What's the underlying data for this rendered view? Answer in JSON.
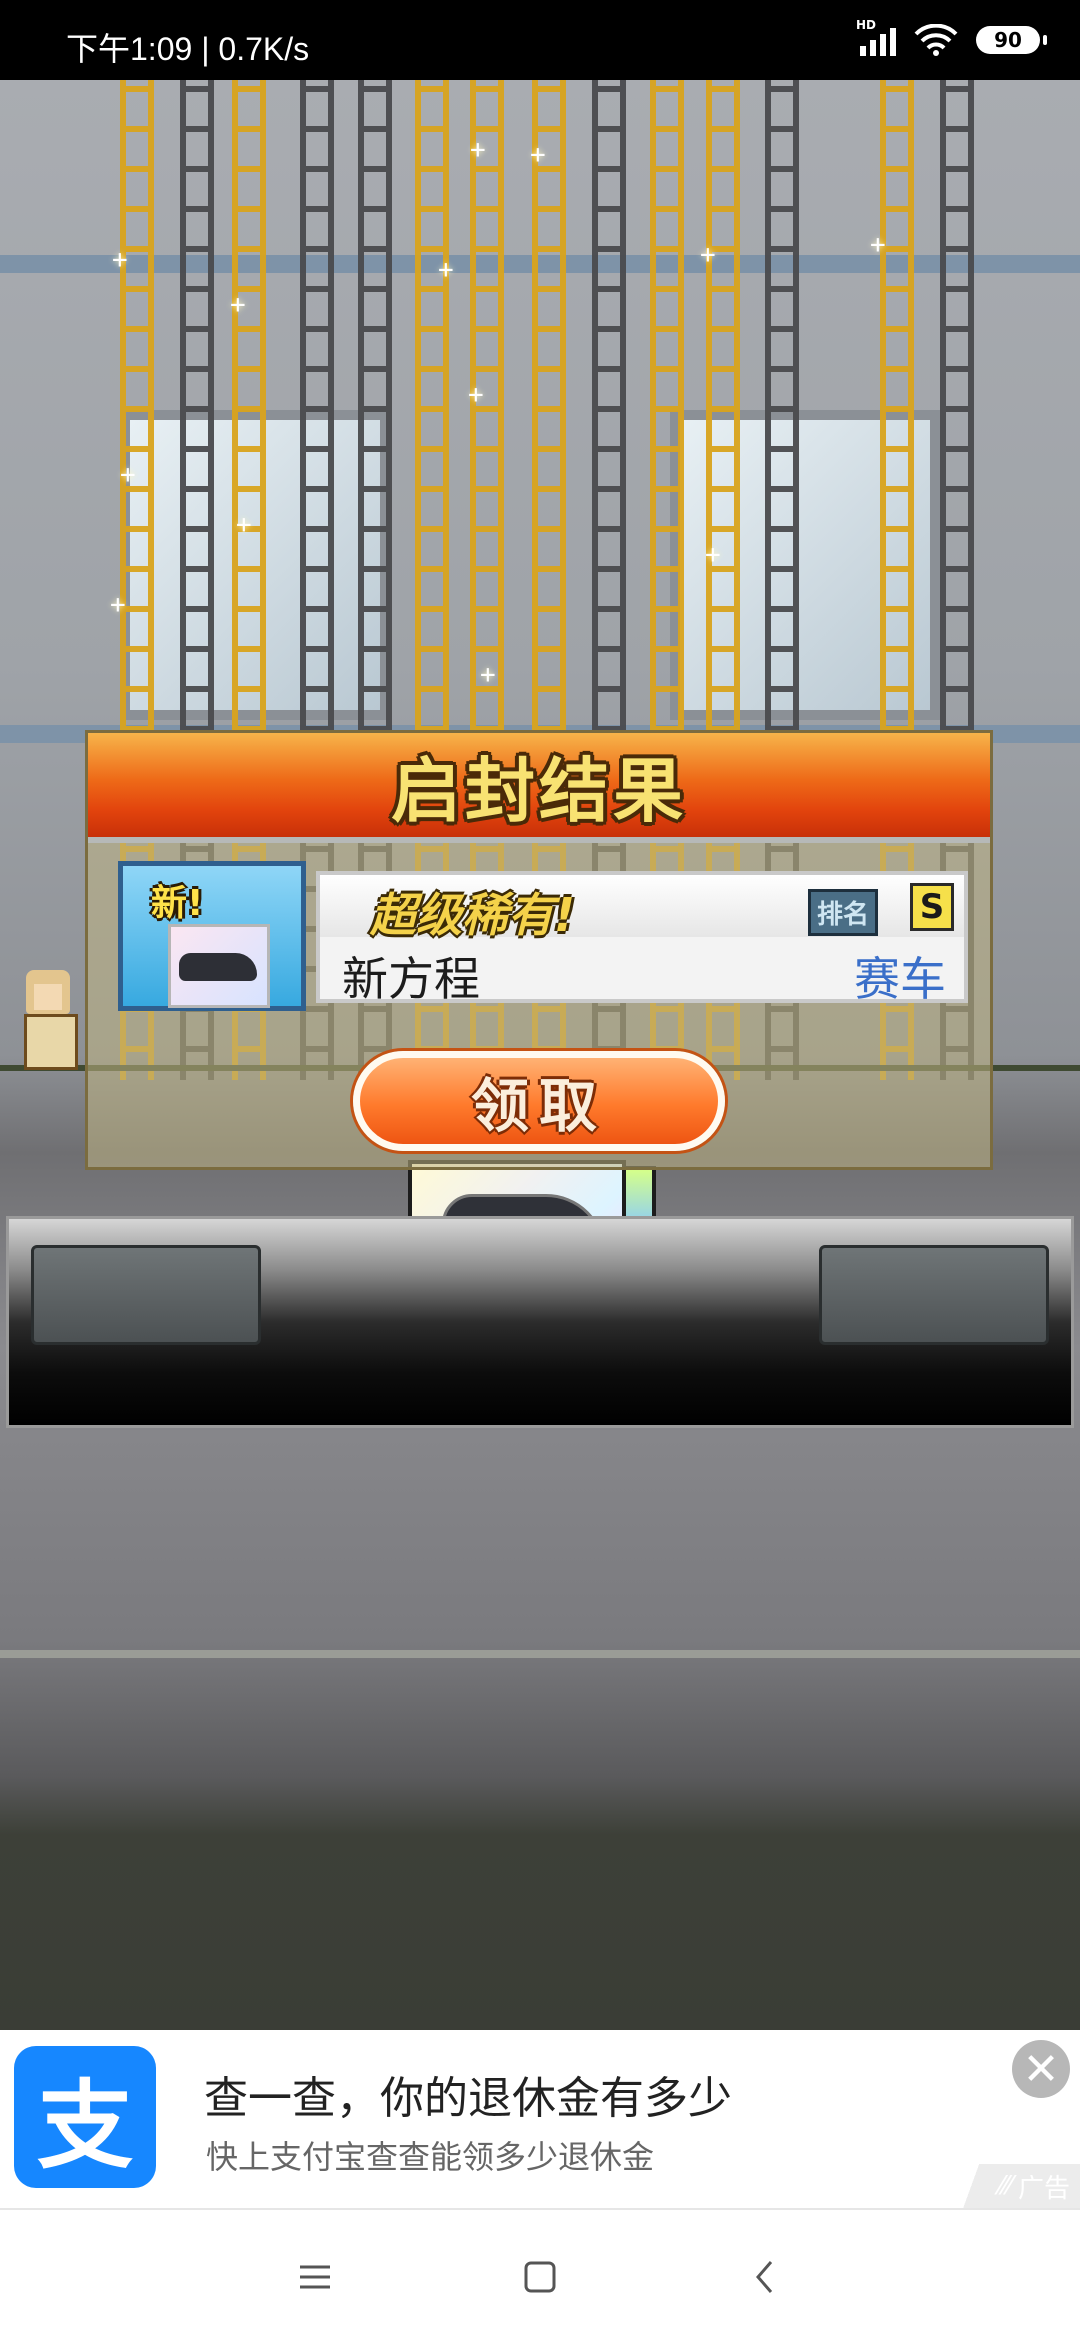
{
  "status_bar": {
    "time": "下午1:09",
    "network_speed": "0.7K/s",
    "signal_label": "HD",
    "battery": "90"
  },
  "result_panel": {
    "title": "启封结果",
    "new_badge": "新!",
    "rarity": "超级稀有!",
    "rank_label": "排名",
    "rank_value": "S",
    "item_name": "新方程",
    "item_type": "赛车",
    "claim_button": "领取"
  },
  "ad": {
    "logo_glyph": "支",
    "title": "查一查，你的退休金有多少",
    "subtitle": "快上支付宝查查能领多少退休金",
    "tag": "广告",
    "close_glyph": "✕"
  },
  "colors": {
    "header_orange": "#e2430d",
    "title_yellow": "#f8e272",
    "item_type_blue": "#3a6fc9",
    "alipay_blue": "#1687ff"
  },
  "icons": {
    "signal": "signal-icon",
    "wifi": "wifi-icon",
    "battery": "battery-icon",
    "menu": "menu-icon",
    "home": "home-icon",
    "back": "back-icon"
  }
}
